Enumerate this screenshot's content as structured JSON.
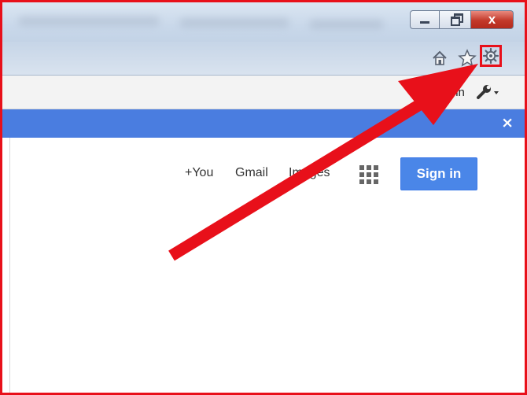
{
  "window": {
    "controls": {
      "minimize_icon": "minimize-icon",
      "restore_icon": "restore-icon",
      "close_label": "x"
    }
  },
  "toolbar": {
    "icons": [
      "home-icon",
      "star-icon",
      "gear-icon"
    ]
  },
  "command_bar": {
    "sign_in_partial": "Sign in",
    "tools_icon": "wrench-icon"
  },
  "notification_bar": {
    "close_label": "×",
    "color": "#4a7de0"
  },
  "google_bar": {
    "links": [
      "+You",
      "Gmail",
      "Images"
    ],
    "apps_icon": "apps-grid-icon",
    "sign_in_button": "Sign in",
    "button_color": "#4a86e8"
  },
  "annotation": {
    "arrow_color": "#e8101a",
    "highlight": "gear-icon"
  }
}
